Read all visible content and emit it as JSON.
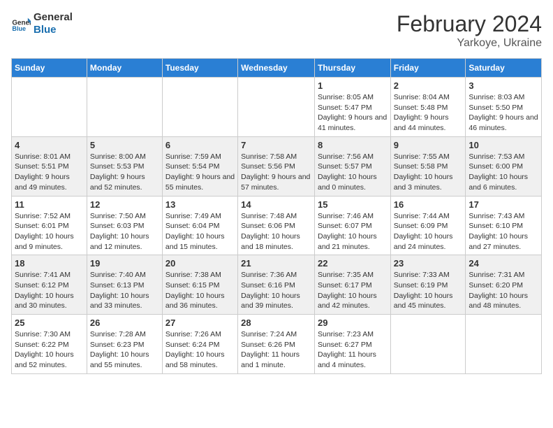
{
  "header": {
    "logo_line1": "General",
    "logo_line2": "Blue",
    "month": "February 2024",
    "location": "Yarkoye, Ukraine"
  },
  "days_of_week": [
    "Sunday",
    "Monday",
    "Tuesday",
    "Wednesday",
    "Thursday",
    "Friday",
    "Saturday"
  ],
  "weeks": [
    [
      {
        "day": "",
        "info": ""
      },
      {
        "day": "",
        "info": ""
      },
      {
        "day": "",
        "info": ""
      },
      {
        "day": "",
        "info": ""
      },
      {
        "day": "1",
        "info": "Sunrise: 8:05 AM\nSunset: 5:47 PM\nDaylight: 9 hours and 41 minutes."
      },
      {
        "day": "2",
        "info": "Sunrise: 8:04 AM\nSunset: 5:48 PM\nDaylight: 9 hours and 44 minutes."
      },
      {
        "day": "3",
        "info": "Sunrise: 8:03 AM\nSunset: 5:50 PM\nDaylight: 9 hours and 46 minutes."
      }
    ],
    [
      {
        "day": "4",
        "info": "Sunrise: 8:01 AM\nSunset: 5:51 PM\nDaylight: 9 hours and 49 minutes."
      },
      {
        "day": "5",
        "info": "Sunrise: 8:00 AM\nSunset: 5:53 PM\nDaylight: 9 hours and 52 minutes."
      },
      {
        "day": "6",
        "info": "Sunrise: 7:59 AM\nSunset: 5:54 PM\nDaylight: 9 hours and 55 minutes."
      },
      {
        "day": "7",
        "info": "Sunrise: 7:58 AM\nSunset: 5:56 PM\nDaylight: 9 hours and 57 minutes."
      },
      {
        "day": "8",
        "info": "Sunrise: 7:56 AM\nSunset: 5:57 PM\nDaylight: 10 hours and 0 minutes."
      },
      {
        "day": "9",
        "info": "Sunrise: 7:55 AM\nSunset: 5:58 PM\nDaylight: 10 hours and 3 minutes."
      },
      {
        "day": "10",
        "info": "Sunrise: 7:53 AM\nSunset: 6:00 PM\nDaylight: 10 hours and 6 minutes."
      }
    ],
    [
      {
        "day": "11",
        "info": "Sunrise: 7:52 AM\nSunset: 6:01 PM\nDaylight: 10 hours and 9 minutes."
      },
      {
        "day": "12",
        "info": "Sunrise: 7:50 AM\nSunset: 6:03 PM\nDaylight: 10 hours and 12 minutes."
      },
      {
        "day": "13",
        "info": "Sunrise: 7:49 AM\nSunset: 6:04 PM\nDaylight: 10 hours and 15 minutes."
      },
      {
        "day": "14",
        "info": "Sunrise: 7:48 AM\nSunset: 6:06 PM\nDaylight: 10 hours and 18 minutes."
      },
      {
        "day": "15",
        "info": "Sunrise: 7:46 AM\nSunset: 6:07 PM\nDaylight: 10 hours and 21 minutes."
      },
      {
        "day": "16",
        "info": "Sunrise: 7:44 AM\nSunset: 6:09 PM\nDaylight: 10 hours and 24 minutes."
      },
      {
        "day": "17",
        "info": "Sunrise: 7:43 AM\nSunset: 6:10 PM\nDaylight: 10 hours and 27 minutes."
      }
    ],
    [
      {
        "day": "18",
        "info": "Sunrise: 7:41 AM\nSunset: 6:12 PM\nDaylight: 10 hours and 30 minutes."
      },
      {
        "day": "19",
        "info": "Sunrise: 7:40 AM\nSunset: 6:13 PM\nDaylight: 10 hours and 33 minutes."
      },
      {
        "day": "20",
        "info": "Sunrise: 7:38 AM\nSunset: 6:15 PM\nDaylight: 10 hours and 36 minutes."
      },
      {
        "day": "21",
        "info": "Sunrise: 7:36 AM\nSunset: 6:16 PM\nDaylight: 10 hours and 39 minutes."
      },
      {
        "day": "22",
        "info": "Sunrise: 7:35 AM\nSunset: 6:17 PM\nDaylight: 10 hours and 42 minutes."
      },
      {
        "day": "23",
        "info": "Sunrise: 7:33 AM\nSunset: 6:19 PM\nDaylight: 10 hours and 45 minutes."
      },
      {
        "day": "24",
        "info": "Sunrise: 7:31 AM\nSunset: 6:20 PM\nDaylight: 10 hours and 48 minutes."
      }
    ],
    [
      {
        "day": "25",
        "info": "Sunrise: 7:30 AM\nSunset: 6:22 PM\nDaylight: 10 hours and 52 minutes."
      },
      {
        "day": "26",
        "info": "Sunrise: 7:28 AM\nSunset: 6:23 PM\nDaylight: 10 hours and 55 minutes."
      },
      {
        "day": "27",
        "info": "Sunrise: 7:26 AM\nSunset: 6:24 PM\nDaylight: 10 hours and 58 minutes."
      },
      {
        "day": "28",
        "info": "Sunrise: 7:24 AM\nSunset: 6:26 PM\nDaylight: 11 hours and 1 minute."
      },
      {
        "day": "29",
        "info": "Sunrise: 7:23 AM\nSunset: 6:27 PM\nDaylight: 11 hours and 4 minutes."
      },
      {
        "day": "",
        "info": ""
      },
      {
        "day": "",
        "info": ""
      }
    ]
  ]
}
